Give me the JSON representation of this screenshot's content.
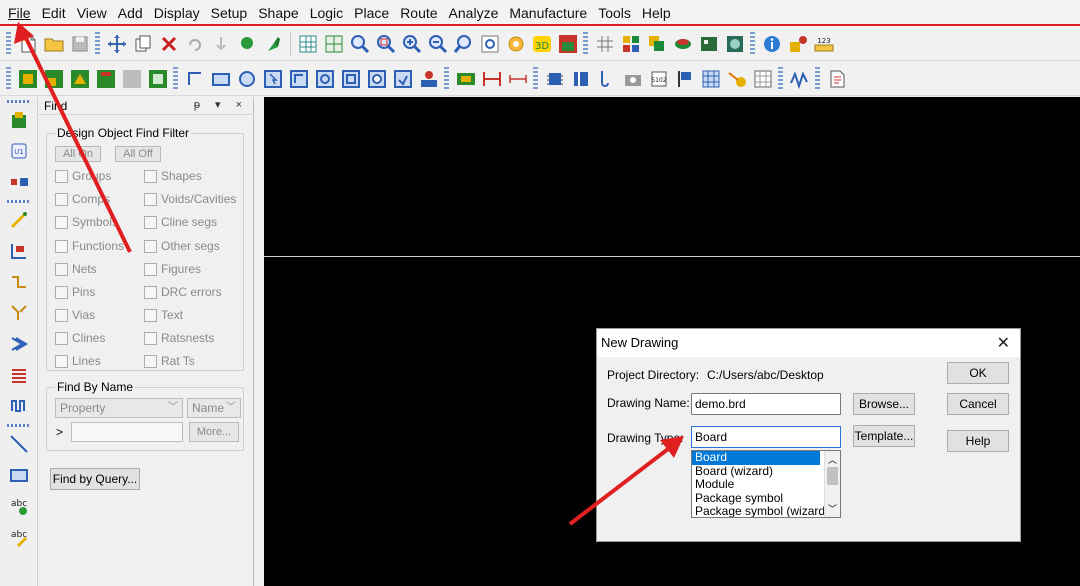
{
  "menu": [
    {
      "label": "File"
    },
    {
      "label": "Edit"
    },
    {
      "label": "View"
    },
    {
      "label": "Add"
    },
    {
      "label": "Display"
    },
    {
      "label": "Setup"
    },
    {
      "label": "Shape"
    },
    {
      "label": "Logic"
    },
    {
      "label": "Place"
    },
    {
      "label": "Route"
    },
    {
      "label": "Analyze"
    },
    {
      "label": "Manufacture"
    },
    {
      "label": "Tools"
    },
    {
      "label": "Help"
    }
  ],
  "find_panel": {
    "title": "Find",
    "controls": "ᵽ ▾ ×",
    "filter_group_title": "Design Object Find Filter",
    "all_on": "All On",
    "all_off": "All Off",
    "checkboxes_left": [
      "Groups",
      "Comps",
      "Symbols",
      "Functions",
      "Nets",
      "Pins",
      "Vias",
      "Clines",
      "Lines"
    ],
    "checkboxes_right": [
      "Shapes",
      "Voids/Cavities",
      "Cline segs",
      "Other segs",
      "Figures",
      "DRC errors",
      "Text",
      "Ratsnests",
      "Rat Ts"
    ],
    "by_name_title": "Find By Name",
    "property_select": "Property",
    "name_select": "Name",
    "expand_glyph": ">",
    "more_button": "More...",
    "query_button": "Find by Query..."
  },
  "dialog": {
    "title": "New Drawing",
    "close_glyph": "✕",
    "project_dir_label": "Project Directory:",
    "project_dir_value": "C:/Users/abc/Desktop",
    "drawing_name_label": "Drawing Name:",
    "drawing_name_value": "demo.brd",
    "drawing_type_label": "Drawing Type:",
    "drawing_type_value": "Board",
    "browse_button": "Browse...",
    "template_button": "Template...",
    "ok_button": "OK",
    "cancel_button": "Cancel",
    "help_button": "Help",
    "type_options": [
      "Board",
      "Board (wizard)",
      "Module",
      "Package symbol",
      "Package symbol (wizard)"
    ],
    "selected_type_index": 0
  },
  "colors": {
    "canvas_bg": "#000000",
    "annotation_red": "#e02020",
    "selection_blue": "#0078d7"
  },
  "icons": {
    "toolbar_row_1": [
      "new-file-icon",
      "open-folder-icon",
      "save-icon",
      "move-icon",
      "copy-icon",
      "delete-icon",
      "undo-icon",
      "redo-icon",
      "pin-icon",
      "snap-icon",
      "grid-icon",
      "grid-alt-icon",
      "zoom-fit-icon",
      "zoom-points-icon",
      "zoom-in-icon",
      "zoom-out-icon",
      "zoom-previous-icon",
      "zoom-world-icon",
      "redraw-icon",
      "3d-view-icon",
      "flip-icon",
      "grid-toggle-icon",
      "color-icon",
      "layers-icon",
      "display-icon",
      "board-icon",
      "globe-icon",
      "info-icon",
      "measure-icon",
      "ruler-icon"
    ],
    "toolbar_row_2": [
      "layer-1-icon",
      "layer-2-icon",
      "layer-3-icon",
      "layer-4-icon",
      "layer-5-icon",
      "layer-6-icon",
      "line-icon",
      "rectangle-icon",
      "circle-icon",
      "select-icon",
      "shape-icon",
      "poly-icon",
      "square-icon",
      "round-square-icon",
      "merge-icon",
      "fill-icon",
      "component-icon",
      "dimension-icon",
      "measure-line-icon",
      "chip-icon",
      "drc-icon",
      "probe-icon",
      "camera-icon",
      "sweep-icon",
      "flag-icon",
      "matrix-icon",
      "key-icon",
      "grid-dots-icon",
      "waveform-icon",
      "page-icon"
    ],
    "vertical_toolbar": [
      "place-manual-icon",
      "component-u1-icon",
      "connector-icon",
      "add-connect-icon",
      "slide-icon",
      "route-icon",
      "fanout-icon",
      "diff-pair-icon",
      "gloss-icon",
      "tuning-icon",
      "arrow-icon",
      "add-line-icon",
      "add-rect-icon",
      "add-text-icon",
      "edit-text-icon"
    ]
  }
}
